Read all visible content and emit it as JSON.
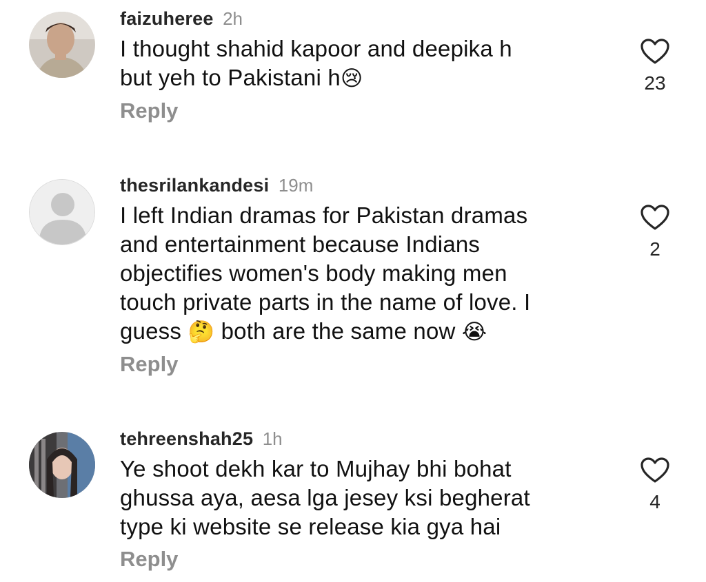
{
  "comments": [
    {
      "username": "faizuheree",
      "time": "2h",
      "lines": [
        "I thought shahid kapoor and deepika h",
        "but yeh to Pakistani h"
      ],
      "emoji_after_line2": "😢",
      "reply_label": "Reply",
      "likes": "23",
      "avatar_icon": "profile-photo"
    },
    {
      "username": "thesrilankandesi",
      "time": "19m",
      "lines": [
        "I left Indian dramas for Pakistan dramas",
        "and entertainment because Indians",
        "objectifies women's body making men",
        "touch private parts in the name of love. I",
        "guess",
        "both are the same now"
      ],
      "emoji_thinking": "🤔",
      "emoji_crying": "😭",
      "reply_label": "Reply",
      "likes": "2",
      "avatar_icon": "default-avatar-icon"
    },
    {
      "username": "tehreenshah25",
      "time": "1h",
      "lines": [
        "Ye shoot dekh kar to Mujhay bhi bohat",
        "ghussa aya, aesa lga jesey ksi begherat",
        "type ki website se release kia gya hai"
      ],
      "reply_label": "Reply",
      "likes": "4",
      "avatar_icon": "profile-photo"
    }
  ],
  "colors": {
    "text": "#111111",
    "secondary": "#8e8e8e",
    "heart_stroke": "#262626"
  }
}
